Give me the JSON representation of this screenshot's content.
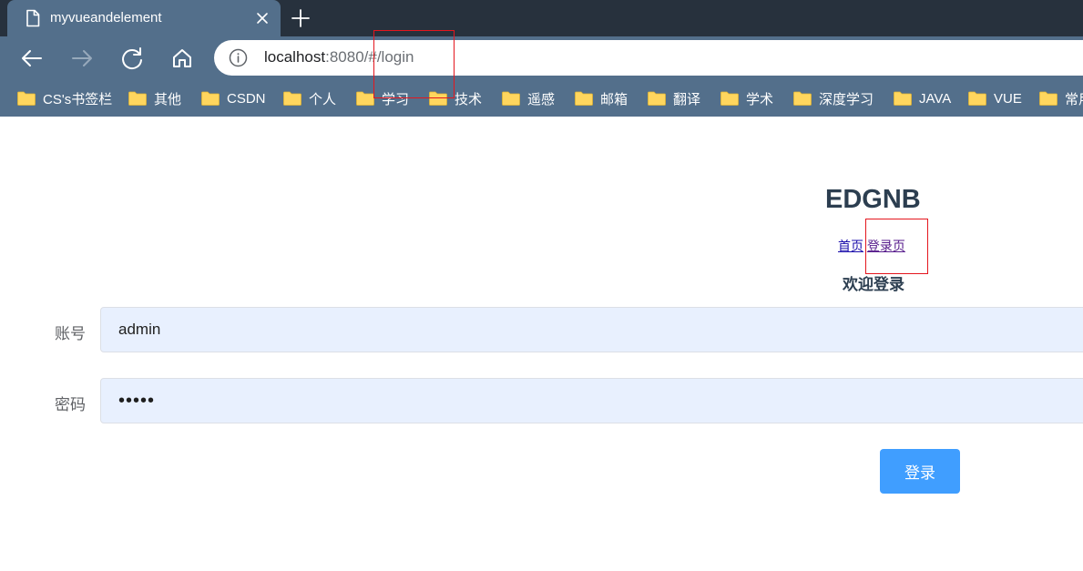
{
  "browser": {
    "tab": {
      "title": "myvueandelement"
    },
    "address_bar": {
      "host": "localhost",
      "rest": ":8080/#/login"
    },
    "bookmarks": [
      {
        "label": "CS's书签栏"
      },
      {
        "label": "其他"
      },
      {
        "label": "CSDN"
      },
      {
        "label": "个人"
      },
      {
        "label": "学习"
      },
      {
        "label": "技术"
      },
      {
        "label": "遥感"
      },
      {
        "label": "邮箱"
      },
      {
        "label": "翻译"
      },
      {
        "label": "学术"
      },
      {
        "label": "深度学习"
      },
      {
        "label": "JAVA"
      },
      {
        "label": "VUE"
      },
      {
        "label": "常用"
      }
    ]
  },
  "page": {
    "title": "EDGNB",
    "nav": {
      "home": "首页",
      "login": "登录页"
    },
    "welcome": "欢迎登录",
    "form": {
      "account_label": "账号",
      "account_value": "admin",
      "password_label": "密码",
      "password_value": "•••••",
      "submit_label": "登录"
    }
  },
  "colors": {
    "tabstrip": "#27313d",
    "toolbar": "#536f8b",
    "primary_button": "#409eff",
    "input_autofill": "#e8f0fe",
    "highlight": "#e4161e"
  }
}
